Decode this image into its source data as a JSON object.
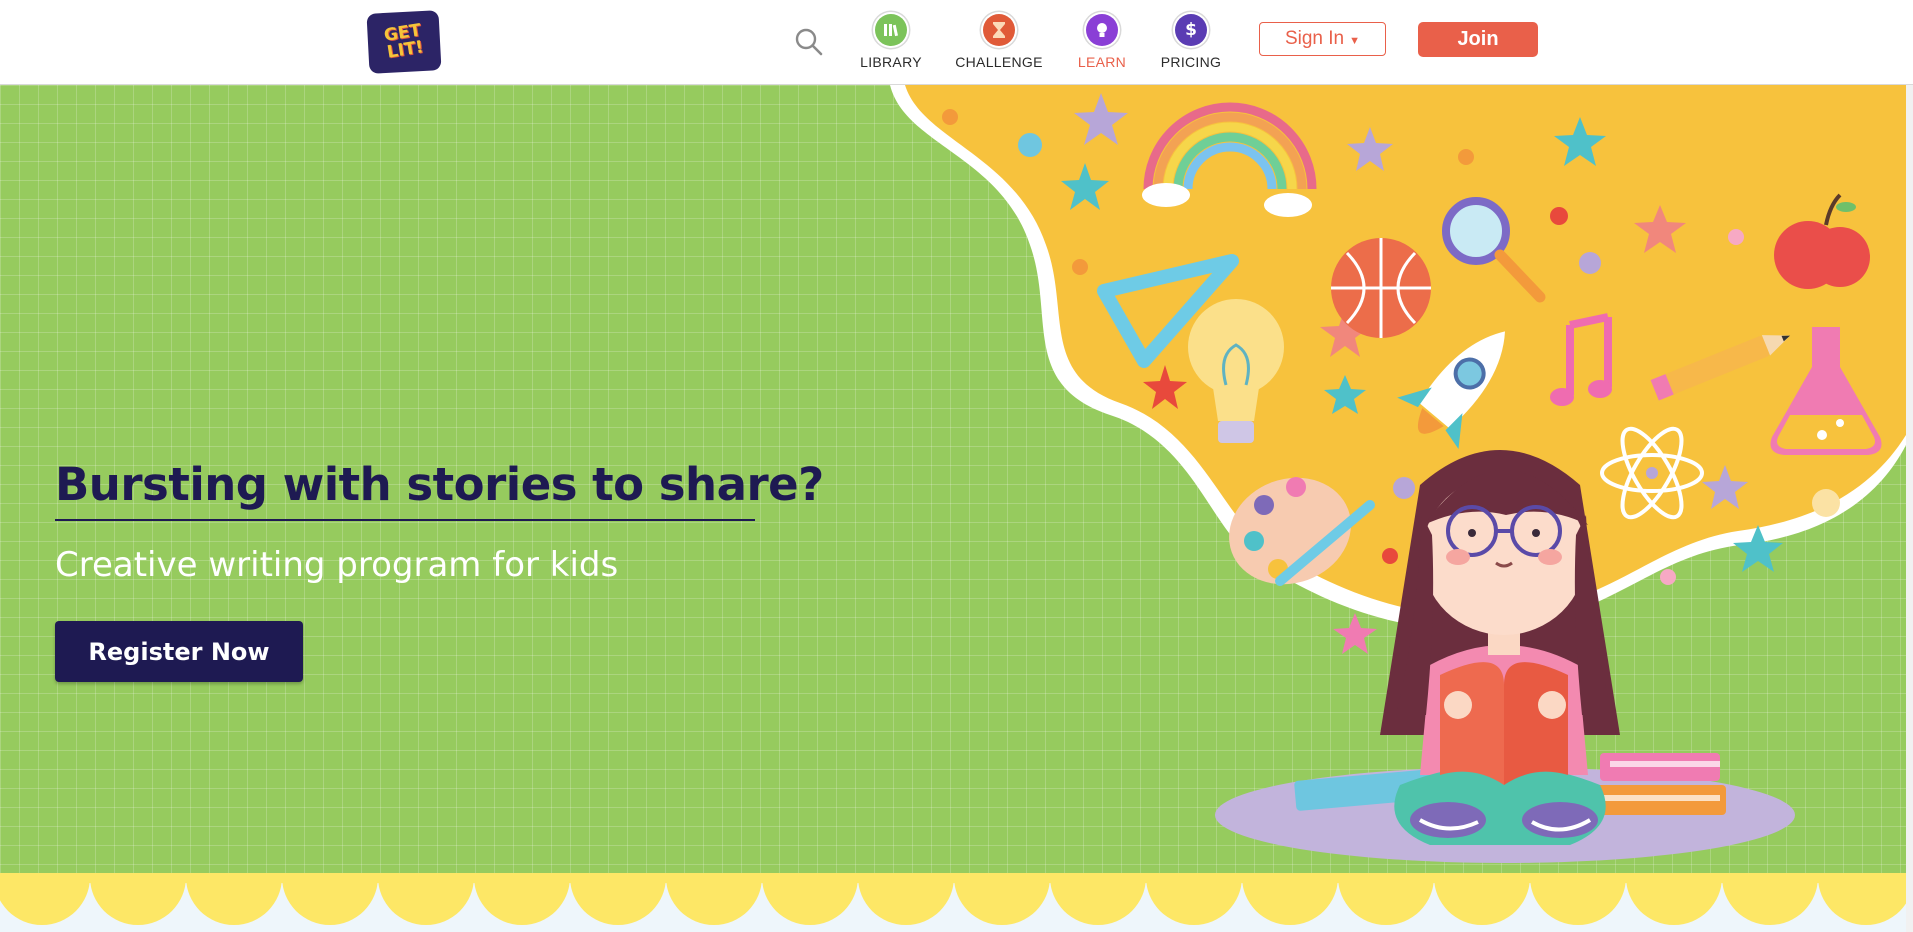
{
  "header": {
    "logo_text": "GET LIT!",
    "nav": [
      {
        "label": "LIBRARY",
        "color": "#7cc35a",
        "icon": "books-icon"
      },
      {
        "label": "CHALLENGE",
        "color": "#e05a38",
        "icon": "hourglass-icon"
      },
      {
        "label": "LEARN",
        "color": "#8a3fd6",
        "icon": "lightbulb-icon",
        "active": true
      },
      {
        "label": "PRICING",
        "color": "#5a3cb3",
        "icon": "dollar-icon"
      }
    ],
    "sign_in_label": "Sign In",
    "join_label": "Join"
  },
  "hero": {
    "title": "Bursting with stories to share?",
    "subtitle": "Creative writing program for kids",
    "cta_label": "Register Now"
  },
  "colors": {
    "accent": "#e9604a",
    "navy": "#1e1a52",
    "hero_green": "#96cb5e",
    "burst_yellow": "#f7c23d",
    "band_yellow": "#fde766"
  }
}
